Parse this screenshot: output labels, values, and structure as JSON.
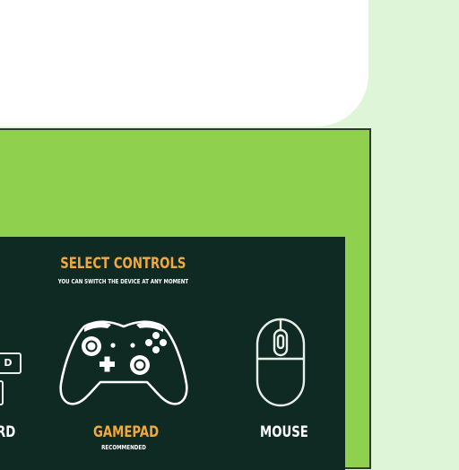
{
  "panel": {
    "title": "SELECT CONTROLS",
    "subtitle": "YOU CAN SWITCH THE DEVICE AT ANY MOMENT"
  },
  "options": {
    "keyboard": {
      "label": "RD",
      "key_hint": "D",
      "icon": "keyboard-icon"
    },
    "gamepad": {
      "label": "GAMEPAD",
      "sublabel": "RECOMMENDED",
      "icon": "gamepad-icon",
      "selected": true
    },
    "mouse": {
      "label": "MOUSE",
      "icon": "mouse-icon"
    }
  },
  "colors": {
    "background": "#dff5d8",
    "frame": "#8fd14f",
    "panel": "#0e2a22",
    "accent": "#f2a93b",
    "text": "#ffffff"
  }
}
